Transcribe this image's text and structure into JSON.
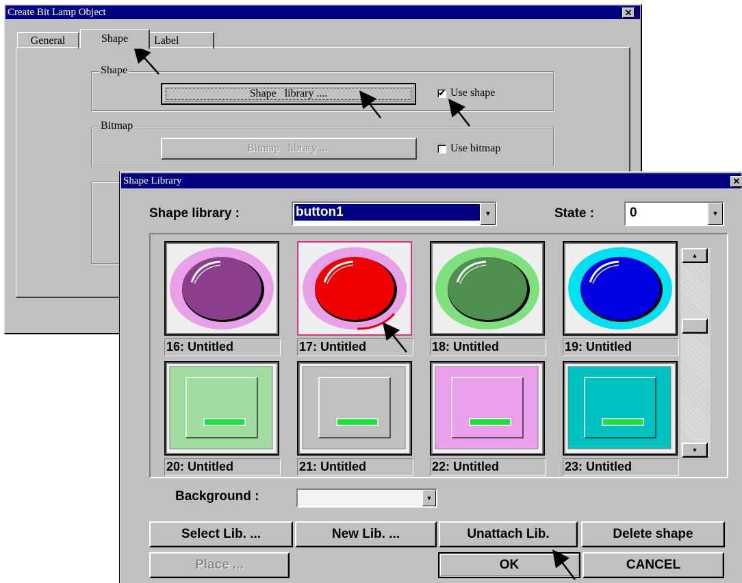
{
  "back_dialog": {
    "title": "Create Bit Lamp Object",
    "close_glyph": "✕",
    "tabs": [
      "General",
      "Shape",
      "Label"
    ],
    "shape_group": {
      "label": "Shape",
      "button": "Shape   library ....",
      "checkbox_label": "Use shape",
      "checked": true
    },
    "bitmap_group": {
      "label": "Bitmap",
      "button": "Bitmap   library ....",
      "checkbox_label": "Use bitmap",
      "checked": false
    }
  },
  "front_dialog": {
    "title": "Shape Library",
    "close_glyph": "✕",
    "library_label": "Shape library :",
    "library_value": "button1",
    "state_label": "State :",
    "state_value": "0",
    "background_label": "Background :",
    "shapes": [
      {
        "caption": "16: Untitled",
        "kind": "round",
        "ring": "#e8a0e8",
        "fill": "#8b3e8e"
      },
      {
        "caption": "17: Untitled",
        "kind": "round",
        "ring": "#e8a0e8",
        "fill": "#ee0000"
      },
      {
        "caption": "18: Untitled",
        "kind": "round",
        "ring": "#80e080",
        "fill": "#4e8f4e"
      },
      {
        "caption": "19: Untitled",
        "kind": "round",
        "ring": "#00e0f0",
        "fill": "#0000e0"
      },
      {
        "caption": "20: Untitled",
        "kind": "square",
        "fill": "#a0dca0"
      },
      {
        "caption": "21: Untitled",
        "kind": "square",
        "fill": "#c0c0c0"
      },
      {
        "caption": "22: Untitled",
        "kind": "square",
        "fill": "#eaa0ea"
      },
      {
        "caption": "23: Untitled",
        "kind": "square",
        "fill": "#00c0c0"
      }
    ],
    "buttons": {
      "select_lib": "Select Lib. ...",
      "new_lib": "New Lib. ...",
      "unattach_lib": "Unattach Lib.",
      "delete_shape": "Delete shape",
      "place": "Place ...",
      "ok": "OK",
      "cancel": "CANCEL"
    }
  },
  "colors": {
    "title_bar": "#000080",
    "face": "#c0c0c0",
    "selection": "#000080",
    "selected_border": "#e03080"
  }
}
